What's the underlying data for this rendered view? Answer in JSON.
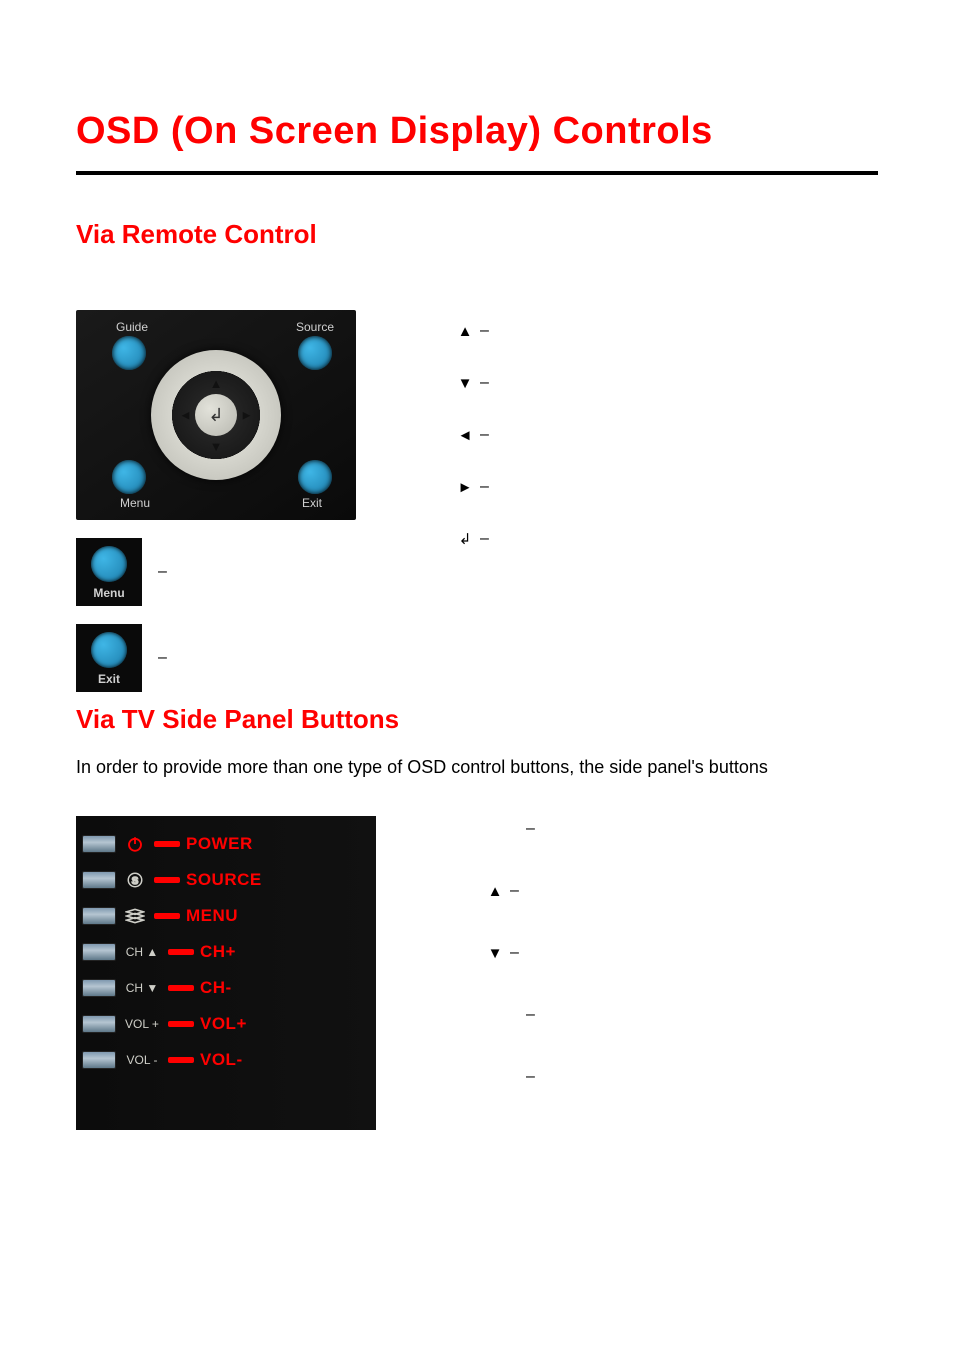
{
  "title": "OSD (On Screen Display) Controls",
  "section_remote": "Via Remote Control",
  "section_side": "Via TV Side Panel Buttons",
  "remote": {
    "corner_labels": {
      "guide": "Guide",
      "source": "Source",
      "menu": "Menu",
      "exit": "Exit"
    },
    "mini_menu": "Menu",
    "mini_exit": "Exit",
    "dash": "–"
  },
  "remote_legend": {
    "up": "–",
    "down": "–",
    "left": "–",
    "right": "–",
    "enter": "–"
  },
  "side_intro": "In order to provide more than one type of OSD control buttons, the side panel's buttons",
  "side_panel": {
    "rows": [
      {
        "icon": "power",
        "icon_text": "",
        "label": "POWER"
      },
      {
        "icon": "source",
        "icon_text": "",
        "label": "SOURCE"
      },
      {
        "icon": "menu",
        "icon_text": "",
        "label": "MENU"
      },
      {
        "icon": "chup",
        "icon_text": "CH ▲",
        "label": "CH+"
      },
      {
        "icon": "chdn",
        "icon_text": "CH ▼",
        "label": "CH-"
      },
      {
        "icon": "volup",
        "icon_text": "VOL +",
        "label": "VOL+"
      },
      {
        "icon": "voldn",
        "icon_text": "VOL -",
        "label": "VOL-"
      }
    ]
  },
  "side_legend": {
    "r1": "–",
    "r2": "–",
    "r3": "–",
    "r4": "–",
    "r5": "–"
  }
}
